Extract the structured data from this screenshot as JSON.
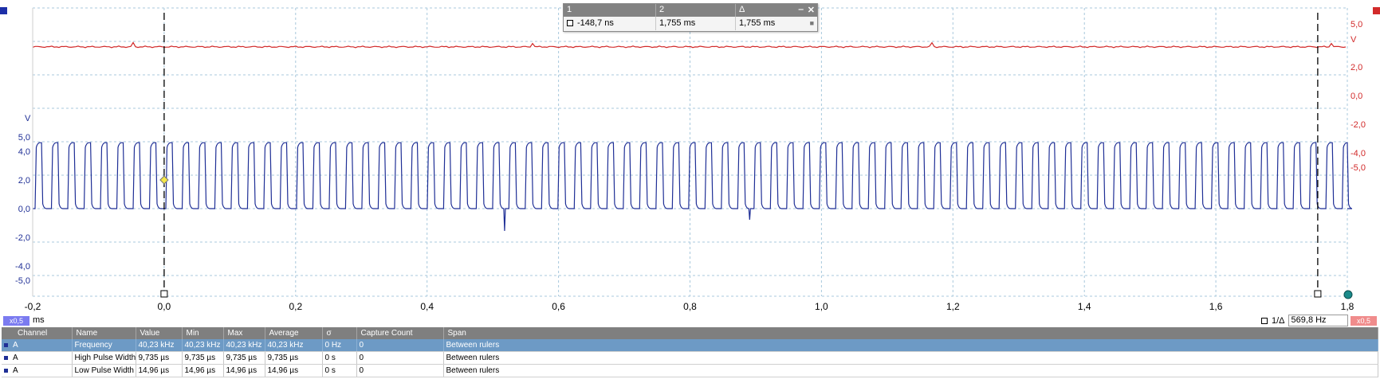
{
  "ruler_panel": {
    "col1_label": "1",
    "col2_label": "2",
    "col3_label": "Δ",
    "col1_value": "-148,7 ns",
    "col2_value": "1,755 ms",
    "col3_value": "1,755 ms",
    "minimize_glyph": "‒",
    "close_glyph": "✕",
    "lock_glyph": "🔓"
  },
  "chart_data": {
    "type": "line",
    "xlabel": "ms",
    "xlim": [
      -0.2,
      1.8
    ],
    "x_ticks": [
      "-0,2",
      "0,0",
      "0,2",
      "0,4",
      "0,6",
      "0,8",
      "1,0",
      "1,2",
      "1,4",
      "1,6",
      "1,8"
    ],
    "left_axis": {
      "unit": "V",
      "ticks": [
        "5,0",
        "4,0",
        "2,0",
        "0,0",
        "-2,0",
        "-4,0",
        "-5,0"
      ],
      "tick_values": [
        5,
        4,
        2,
        0,
        -2,
        -4,
        -5
      ],
      "color": "#1f2f96"
    },
    "right_axis": {
      "unit": "V",
      "ticks": [
        "5,0",
        "2,0",
        "0,0",
        "-2,0",
        "-4,0",
        "-5,0"
      ],
      "tick_values": [
        5,
        2,
        0,
        -2,
        -4,
        -5
      ],
      "color": "#d22a2a"
    },
    "series": [
      {
        "id": "channel-a",
        "color": "#1f2f96",
        "kind": "square",
        "high_v": 4.6,
        "low_v": 0.0,
        "frequency_khz": 40.23,
        "duty": 0.394
      },
      {
        "id": "channel-b",
        "color": "#d22a2a",
        "kind": "dc",
        "level_v": 3.4
      }
    ],
    "rulers_ms": [
      0.0,
      1.755
    ],
    "trigger_marker_v": 2.0,
    "grid": true
  },
  "left_scale_chip": "x0,5",
  "right_scale_chip": "x0,5",
  "x_unit": "ms",
  "freq_readout": {
    "label": "1/Δ",
    "value": "569,8 Hz"
  },
  "measurements": {
    "headers": [
      "Channel",
      "Name",
      "Value",
      "Min",
      "Max",
      "Average",
      "σ",
      "Capture Count",
      "Span"
    ],
    "rows": [
      [
        "A",
        "Frequency",
        "40,23 kHz",
        "40,23 kHz",
        "40,23 kHz",
        "40,23 kHz",
        "0 Hz",
        "0",
        "Between rulers"
      ],
      [
        "A",
        "High Pulse Width",
        "9,735 µs",
        "9,735 µs",
        "9,735 µs",
        "9,735 µs",
        "0 s",
        "0",
        "Between rulers"
      ],
      [
        "A",
        "Low Pulse Width",
        "14,96 µs",
        "14,96 µs",
        "14,96 µs",
        "14,96 µs",
        "0 s",
        "0",
        "Between rulers"
      ]
    ],
    "selected_row": 0
  },
  "colors": {
    "blue_channel": "#1f2f96",
    "red_channel": "#d22a2a",
    "grid": "#a8c8dc",
    "selection": "#6d9ac5"
  }
}
